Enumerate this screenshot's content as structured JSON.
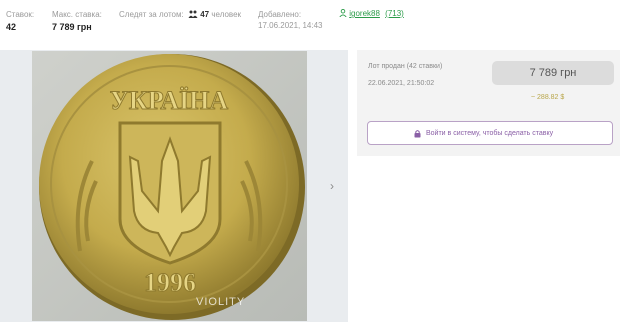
{
  "stats": {
    "bids_label": "Ставок:",
    "bids_value": "42",
    "max_bid_label": "Макс. ставка:",
    "max_bid_value": "7 789 грн",
    "watchers_label": "Следят за лотом:",
    "watchers_count": "47",
    "watchers_unit": "человек",
    "added_label": "Добавлено:",
    "added_value": "17.06.2021, 14:43"
  },
  "seller": {
    "name": "igorek88",
    "rating": "(713)"
  },
  "gallery": {
    "watermark": "VIOLITY",
    "next_arrow": "›",
    "coin_legend": "УКРАЇНА",
    "coin_year": "1996"
  },
  "sale": {
    "status": "Лот продан (42 ставки)",
    "date": "22.06.2021, 21:50:02",
    "price": "7 789 грн",
    "price_usd": "~ 288.82 $",
    "login_text": "Войти в систему, чтобы сделать ставку"
  },
  "icons": {
    "watchers": "people-icon",
    "seller": "user-icon",
    "login": "lock-icon",
    "next": "chevron-right-icon"
  },
  "colors": {
    "seller_link": "#2c9c4a",
    "login_accent": "#8a5fa6",
    "usd": "#b9a64a",
    "panel_bg": "#f3f3f3"
  }
}
